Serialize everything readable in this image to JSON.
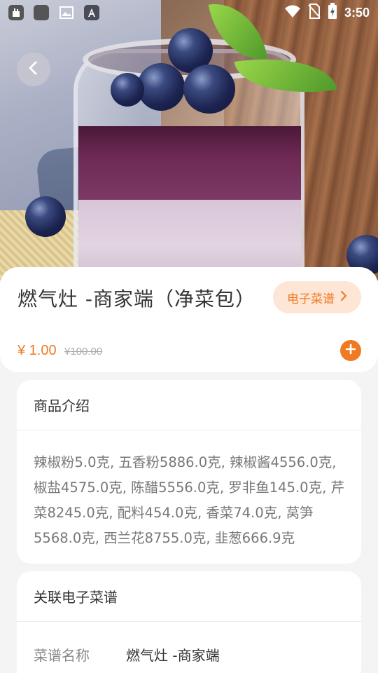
{
  "status_bar": {
    "time": "3:50",
    "icons": [
      "app-icon",
      "app-icon",
      "image-icon",
      "font-icon",
      "wifi-icon",
      "no-sim-icon",
      "battery-icon"
    ]
  },
  "hero": {
    "image_subject": "blueberry dessert jar"
  },
  "product": {
    "title": "燃气灶 -商家端（净菜包）",
    "menu_chip_label": "电子菜谱",
    "price": "¥ 1.00",
    "old_price": "¥100.00"
  },
  "intro": {
    "heading": "商品介绍",
    "text": "辣椒粉5.0克, 五香粉5886.0克, 辣椒酱4556.0克, 椒盐4575.0克, 陈醋5556.0克, 罗非鱼145.0克, 芹菜8245.0克, 配料454.0克, 香菜74.0克, 莴笋5568.0克, 西兰花8755.0克, 韭葱666.9克"
  },
  "recipe": {
    "heading": "关联电子菜谱",
    "name_label": "菜谱名称",
    "name_value": "燃气灶 -商家端"
  },
  "colors": {
    "accent": "#f07a22",
    "chip_bg": "#fde6d6",
    "page_bg": "#f4f4f4"
  }
}
